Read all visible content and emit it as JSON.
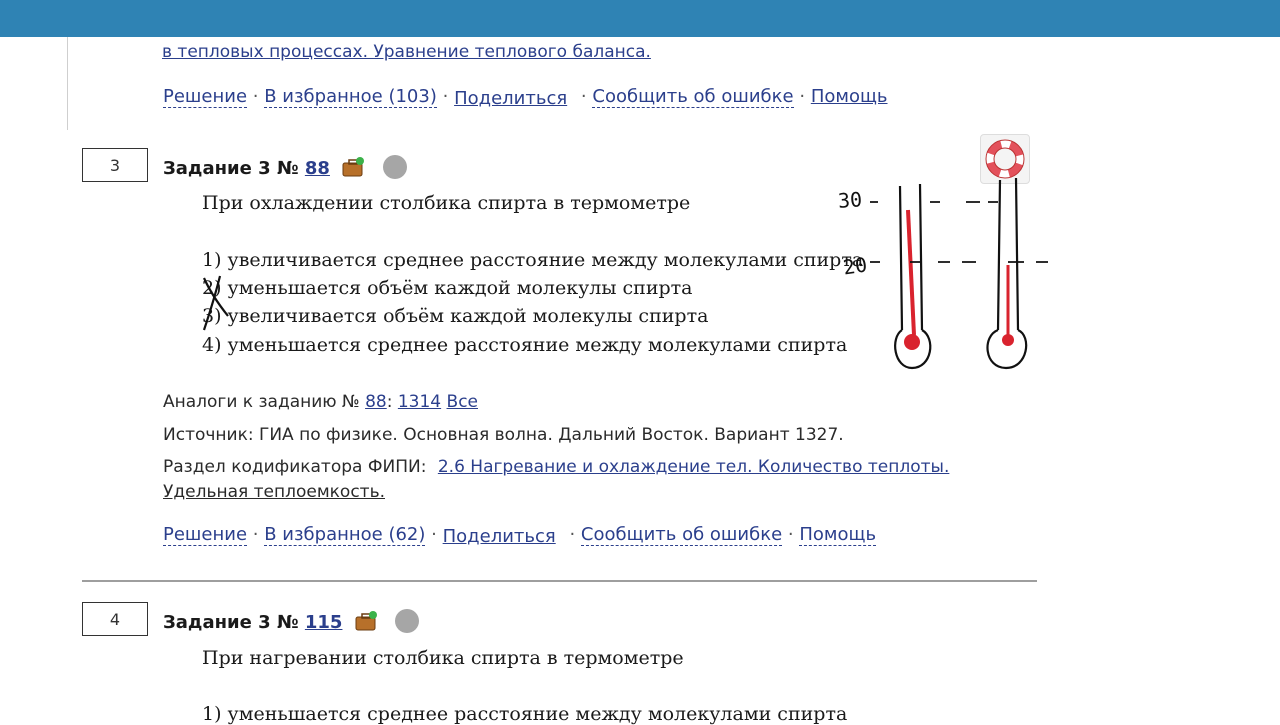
{
  "prev_task": {
    "section_link": "в тепловых процессах. Уравнение теплового баланса.",
    "actions": {
      "solution": "Решение",
      "favorites": "В избранное (103)",
      "share": "Поделиться",
      "report": "Сообщить об ошибке",
      "help": "Помощь"
    }
  },
  "task3": {
    "box_number": "3",
    "title": "Задание 3 №",
    "id_link": "88",
    "question": "При охлаждении столбика спирта в термометре",
    "options": [
      "1) увеличивается среднее расстояние между молекулами спирта",
      "2) уменьшается объём каждой молекулы спирта",
      "3) увеличивается объём каждой молекулы спирта",
      "4) уменьшается среднее расстояние между молекулами спирта"
    ],
    "analogs_label": "Аналоги к заданию №",
    "analogs_id": "88",
    "analogs_colon": ":",
    "analogs_link": "1314",
    "analogs_all": "Все",
    "source": "Источник: ГИА по физике. Основная волна. Дальний Восток. Вариант 1327.",
    "codifier_label": "Раздел кодификатора ФИПИ:",
    "codifier_link_1": "2.6 Нагревание и охлаждение тел. Количество теплоты.",
    "codifier_link_2": "Удельная теплоемкость.",
    "actions": {
      "solution": "Решение",
      "favorites": "В избранное (62)",
      "share": "Поделиться",
      "report": "Сообщить об ошибке",
      "help": "Помощь"
    }
  },
  "task4": {
    "box_number": "4",
    "title": "Задание 3 №",
    "id_link": "115",
    "question": "При нагревании столбика спирта в термометре",
    "options": [
      "1) уменьшается среднее расстояние между молекулами спирта"
    ]
  },
  "drawing": {
    "label_top": "30",
    "label_bottom": "20"
  },
  "separator": "·",
  "colors": {
    "topbar": "#2f83b4",
    "link": "#2b3f8c",
    "thermometer_fill": "#d9232e"
  },
  "icons": [
    "briefcase-icon",
    "status-dot-icon",
    "lifebuoy-icon"
  ]
}
